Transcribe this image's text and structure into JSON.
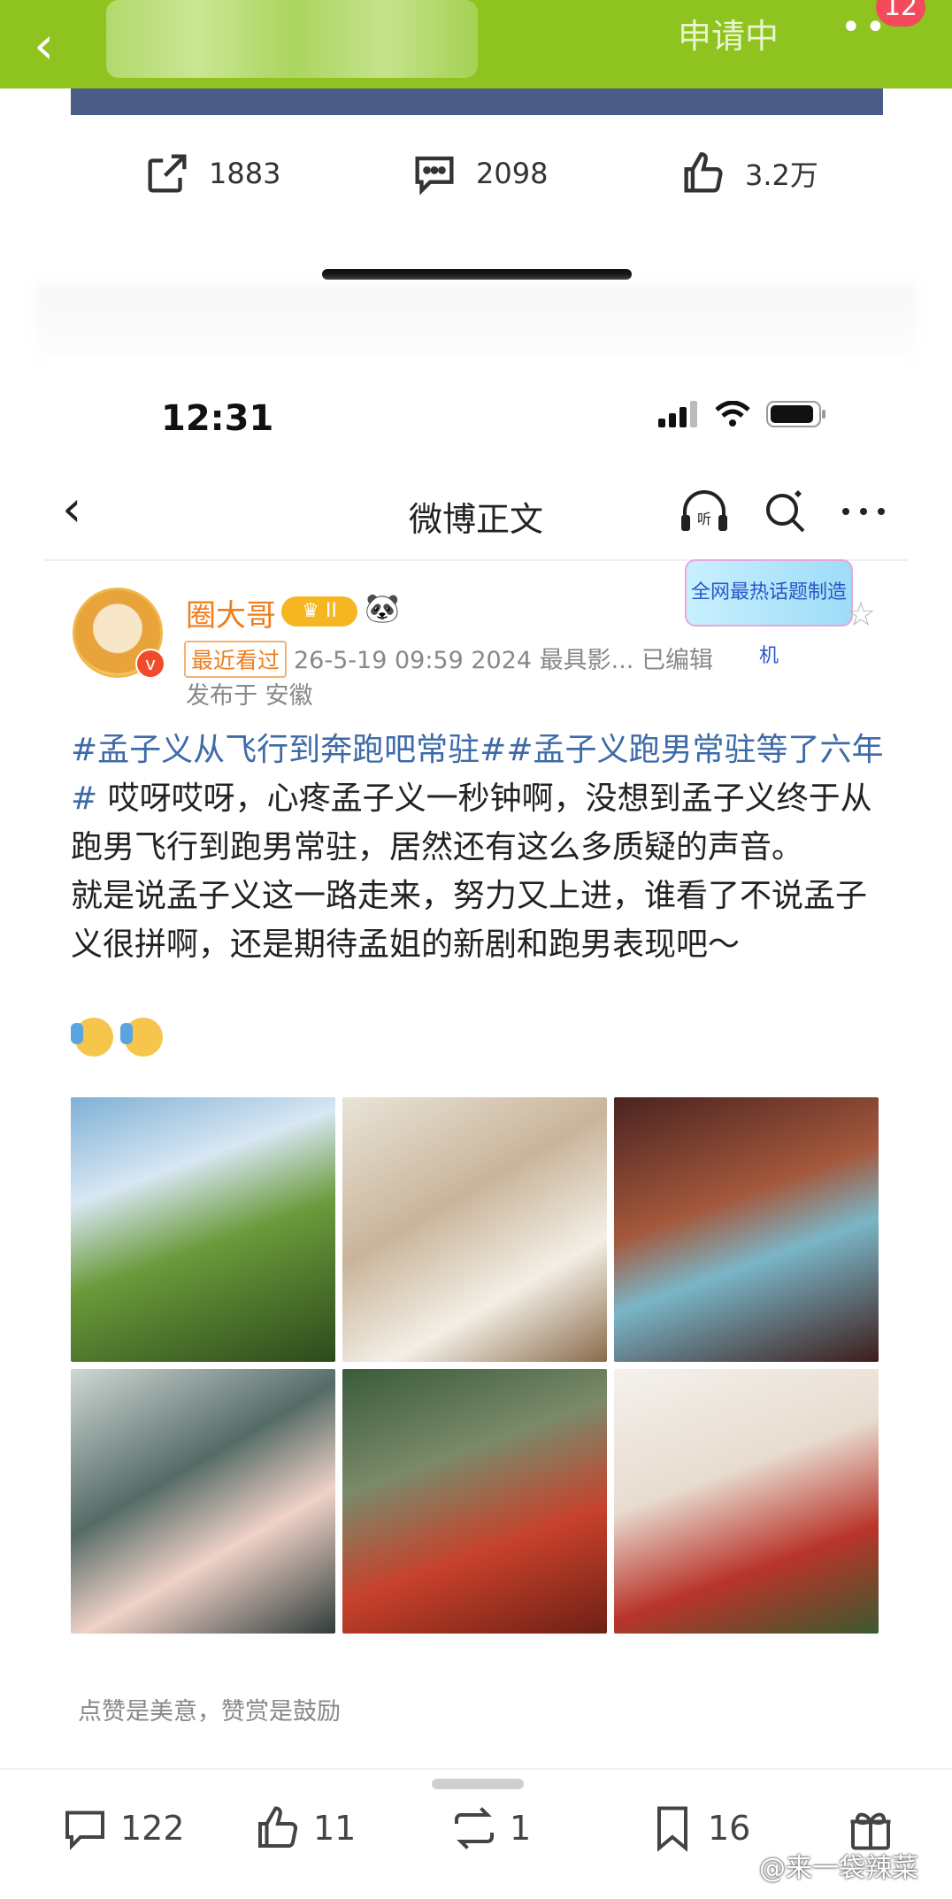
{
  "top_bar": {
    "status_label": "申请中",
    "notification_count": "12"
  },
  "stats": {
    "shares": "1883",
    "comments": "2098",
    "likes": "3.2万"
  },
  "status_bar": {
    "time": "12:31"
  },
  "nav": {
    "title": "微博正文",
    "listen_icon": "headphones-icon",
    "search_icon": "search-icon",
    "more_icon": "more-icon"
  },
  "post": {
    "username": "圈大哥",
    "badge_level": "II",
    "ad_label": "全网最热话题制造机",
    "recent_label": "最近看过",
    "meta": "26-5-19 09:59  2024 最具影...  已编辑",
    "publish": "发布于 安徽",
    "hashtag1": "#孟子义从飞行到奔跑吧常驻#",
    "hashtag2": "#孟子义跑男常驻等了六年#",
    "text1": " 哎呀哎呀，心疼孟子义一秒钟啊，没想到孟子义终于从跑男飞行到跑男常驻，居然还有这么多质疑的声音。",
    "text2": "就是说孟子义这一路走来，努力又上进，谁看了不说孟子义很拼啊，还是期待孟姐的新剧和跑男表现吧～",
    "reward_text": "点赞是美意，赞赏是鼓励"
  },
  "toolbar": {
    "comments": "122",
    "likes": "11",
    "reposts": "1",
    "favorites": "16"
  },
  "watermark": "@来一袋辣菜"
}
